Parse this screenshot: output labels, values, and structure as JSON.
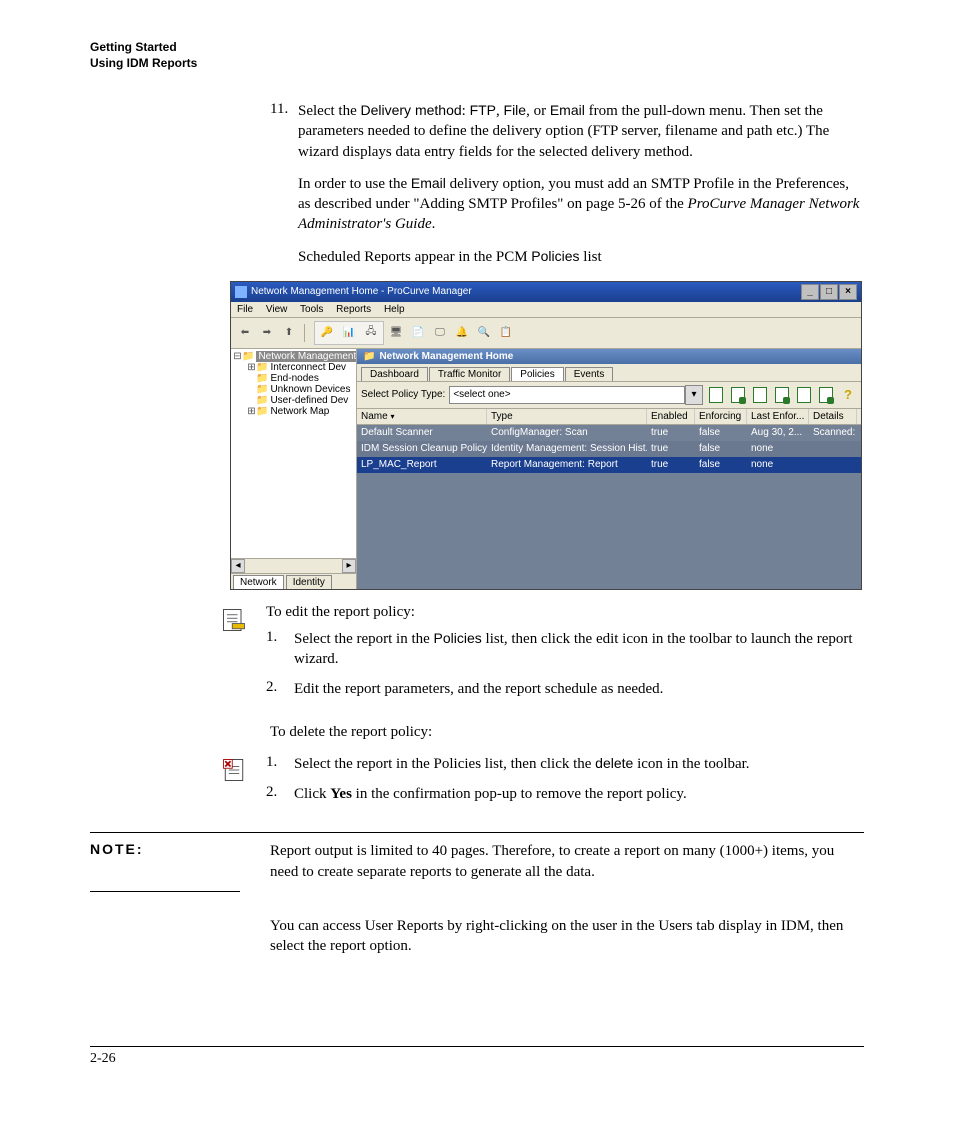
{
  "header": {
    "line1": "Getting Started",
    "line2": "Using IDM Reports"
  },
  "step11": {
    "num": "11.",
    "text_a": "Select the ",
    "delivery": "Delivery method",
    "text_b": ": ",
    "ftp": "FTP",
    "comma1": ", ",
    "file": "File",
    "comma2": ", or ",
    "email": "Email",
    "text_c": " from the pull-down menu. Then set the parameters needed to define the delivery option (FTP server, filename and path etc.) The wizard displays data entry fields for the selected delivery method."
  },
  "para_email_a": "In order to use the ",
  "para_email_term": "Email",
  "para_email_b": " delivery option, you must add an SMTP Profile in the Preferences, as described under \"Adding SMTP Profiles\" on page 5-26 of the ",
  "para_email_italic": "ProCurve Manager Network Administrator's Guide",
  "para_email_c": ".",
  "para_sched_a": "Scheduled Reports appear in the PCM ",
  "para_sched_term": "Policies",
  "para_sched_b": " list",
  "app": {
    "title": "Network Management Home - ProCurve Manager",
    "menus": [
      "File",
      "View",
      "Tools",
      "Reports",
      "Help"
    ],
    "tree": {
      "root": "Network Management",
      "items": [
        "Interconnect Dev",
        "End-nodes",
        "Unknown Devices",
        "User-defined Dev",
        "Network Map"
      ]
    },
    "bottom_tabs": {
      "a": "Network",
      "b": "Identity"
    },
    "panel_title": "Network Management Home",
    "sub_tabs": [
      "Dashboard",
      "Traffic Monitor",
      "Policies",
      "Events"
    ],
    "filter_label": "Select Policy Type:",
    "filter_value": "<select one>",
    "columns": [
      "Name",
      "Type",
      "Enabled",
      "Enforcing",
      "Last Enfor...",
      "Details"
    ],
    "rows": [
      {
        "name": "Default Scanner",
        "type": "ConfigManager: Scan",
        "enabled": "true",
        "enforcing": "false",
        "last": "Aug 30, 2...",
        "details": "Scanned: ..."
      },
      {
        "name": "IDM Session Cleanup Policy",
        "type": "Identity Management: Session Hist...",
        "enabled": "true",
        "enforcing": "false",
        "last": "none",
        "details": ""
      },
      {
        "name": "LP_MAC_Report",
        "type": "Report Management: Report",
        "enabled": "true",
        "enforcing": "false",
        "last": "none",
        "details": ""
      }
    ]
  },
  "edit_block": {
    "lead": "To edit the report policy:",
    "s1_num": "1.",
    "s1_a": "Select the report in the ",
    "s1_term": "Policies",
    "s1_b": " list, then click the edit icon in the toolbar to launch the report wizard.",
    "s2_num": "2.",
    "s2": "Edit the report parameters, and the report schedule as needed."
  },
  "delete_block": {
    "lead": "To delete the report policy:",
    "s1_num": "1.",
    "s1_a": "Select the report in the Policies list, then click the ",
    "s1_term": "delete",
    "s1_b": " icon in the toolbar.",
    "s2_num": "2.",
    "s2_a": "Click ",
    "s2_bold": "Yes",
    "s2_b": " in the confirmation pop-up to remove the report policy."
  },
  "note": {
    "label": "NOTE:",
    "body": "Report output is limited to 40 pages. Therefore, to create a report on many (1000+) items, you need to create separate reports to generate all the data."
  },
  "closing": "You can access User Reports by right-clicking on the user in the Users tab display in IDM, then select the report option.",
  "page_number": "2-26"
}
